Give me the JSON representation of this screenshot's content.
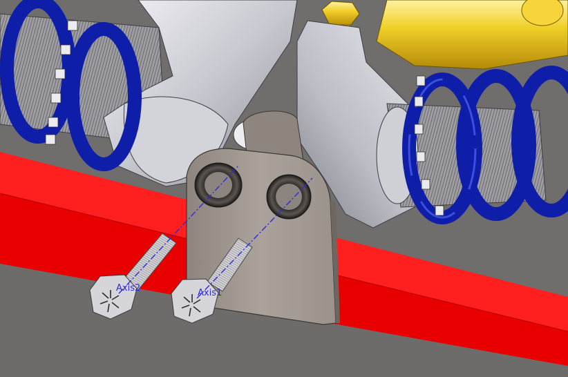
{
  "viewport": {
    "background_color": "#6f6d6b"
  },
  "colors": {
    "frame_beam": "#ff1a1a",
    "spring_coil": "#0f1ea8",
    "damper_body": "#e8c21a",
    "axis_line": "#2a2ae0",
    "bracket_plate": "#a49c95",
    "shock_housing": "#c4c4cc",
    "bolt_steel": "#cfcfd2"
  },
  "parts": {
    "left_shock_absorber": "left-shock-absorber",
    "right_shock_absorber": "right-shock-absorber",
    "mounting_bracket": "mounting-bracket",
    "frame_member": "frame-member",
    "bolt_1": "bolt",
    "bolt_2": "bolt"
  },
  "axes": [
    {
      "id": "axis-2",
      "label": "Axis2"
    },
    {
      "id": "axis-1",
      "label": "Axis1"
    }
  ]
}
